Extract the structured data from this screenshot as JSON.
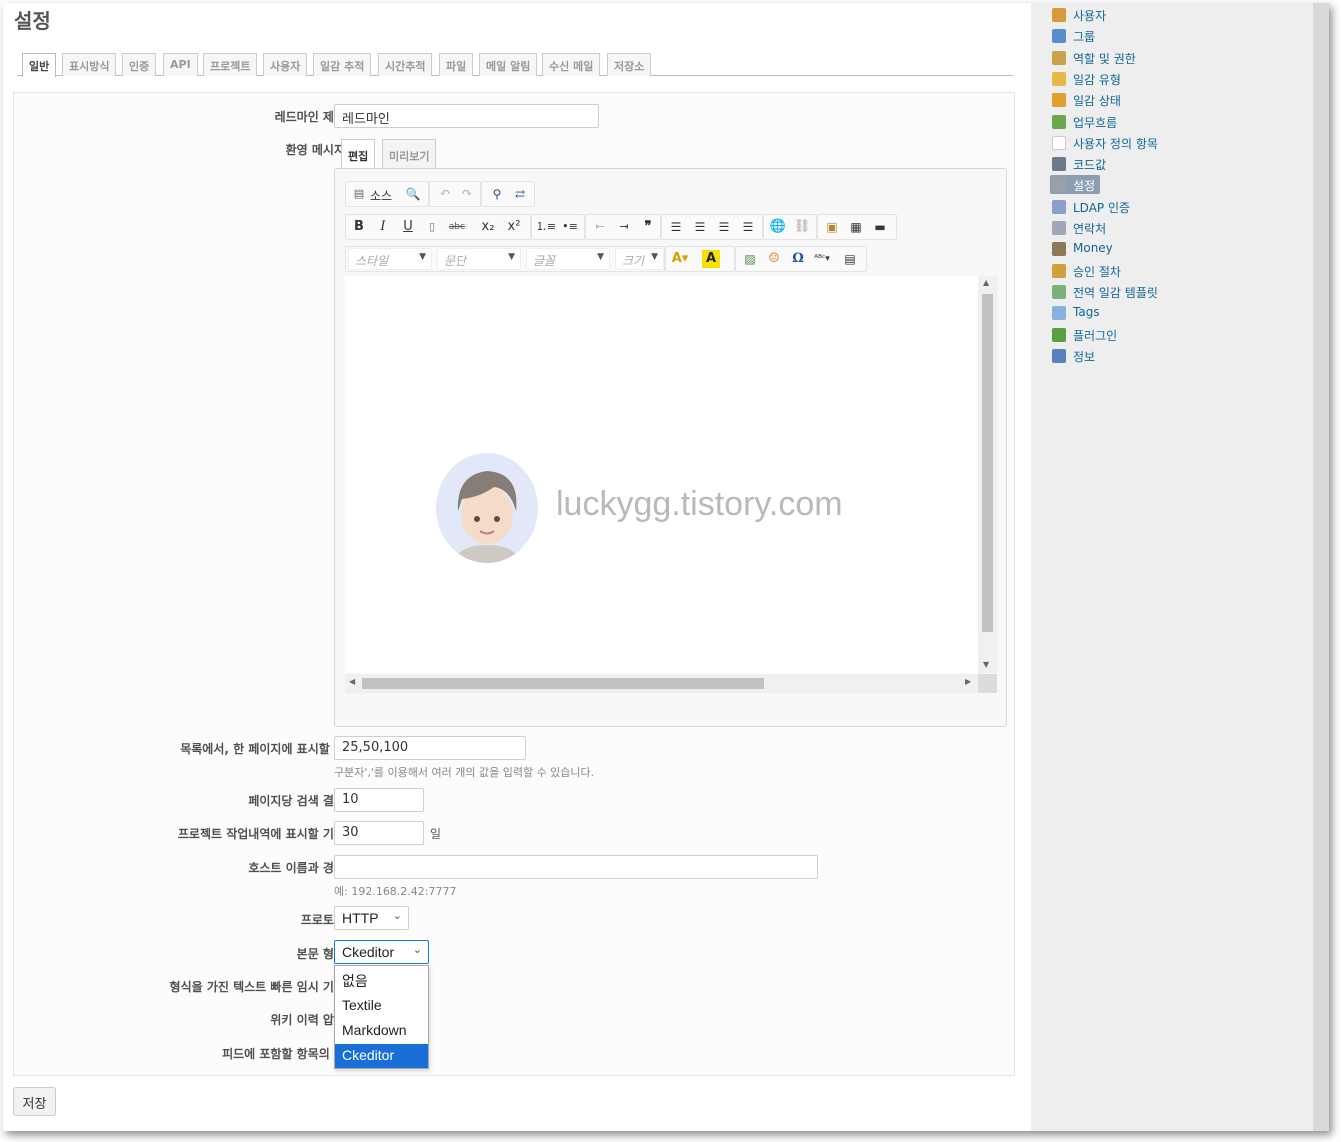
{
  "page": {
    "title": "설정"
  },
  "tabs": [
    "일반",
    "표시방식",
    "인증",
    "API",
    "프로젝트",
    "사용자",
    "일감 추적",
    "시간추적",
    "파일",
    "메일 알림",
    "수신 메일",
    "저장소"
  ],
  "form": {
    "app_title_label": "레드마인 제목",
    "app_title_value": "레드마인",
    "welcome_label": "환영 메시지",
    "editor_tabs": {
      "edit": "편집",
      "preview": "미리보기"
    },
    "toolbar": {
      "source": "소스",
      "combos": {
        "style": "스타일",
        "format": "문단",
        "font": "글꼴",
        "size": "크기"
      }
    },
    "watermark": "luckygg.tistory.com",
    "per_page_label": "목록에서, 한 페이지에 표시할 행",
    "per_page_value": "25,50,100",
    "per_page_hint": "구분자','를 이용해서 여러 개의 값을 입력할 수 있습니다.",
    "search_results_label": "페이지당 검색 결과",
    "search_results_value": "10",
    "activity_days_label": "프로젝트 작업내역에 표시할 기간",
    "activity_days_value": "30",
    "activity_days_unit": "일",
    "host_label": "호스트 이름과 경로",
    "host_value": "",
    "host_hint": "예: 192.168.2.42:7777",
    "protocol_label": "프로토콜",
    "protocol_value": "HTTP",
    "text_format_label": "본문 형식",
    "text_format_value": "Ckeditor",
    "text_format_options": [
      "없음",
      "Textile",
      "Markdown",
      "Ckeditor"
    ],
    "text_format_selected_index": 3,
    "cache_label": "형식을 가진 텍스트 빠른 임시 기억",
    "wiki_compress_label": "위키 이력 압축",
    "feed_limit_label": "피드에 포함할 항목의 수"
  },
  "save_button": "저장",
  "sidebar": {
    "items": [
      {
        "label": "사용자",
        "icon": "user-icon",
        "color": "#d79a3a"
      },
      {
        "label": "그룹",
        "icon": "group-icon",
        "color": "#5b8bd0"
      },
      {
        "label": "역할 및 권한",
        "icon": "key-icon",
        "color": "#c9a34a"
      },
      {
        "label": "일감 유형",
        "icon": "ticket-icon",
        "color": "#e8b84a"
      },
      {
        "label": "일감 상태",
        "icon": "pencil-icon",
        "color": "#e0a030"
      },
      {
        "label": "업무흐름",
        "icon": "workflow-icon",
        "color": "#6aa84f"
      },
      {
        "label": "사용자 정의 항목",
        "icon": "custom-field-icon",
        "color": "#ffffff"
      },
      {
        "label": "코드값",
        "icon": "list-icon",
        "color": "#6a7a8a"
      },
      {
        "label": "설정",
        "icon": "gear-icon",
        "color": "#9aa0a8",
        "selected": true
      },
      {
        "label": "LDAP 인증",
        "icon": "server-icon",
        "color": "#8aa0c8"
      },
      {
        "label": "연락처",
        "icon": "contacts-icon",
        "color": "#a0a8b8"
      },
      {
        "label": "Money",
        "icon": "money-icon",
        "color": "#8a7a5a"
      },
      {
        "label": "승인 절차",
        "icon": "approval-icon",
        "color": "#d0a040"
      },
      {
        "label": "전역 일감 템플릿",
        "icon": "template-icon",
        "color": "#7ab07a"
      },
      {
        "label": "Tags",
        "icon": "tag-icon",
        "color": "#8ab0e0"
      },
      {
        "label": "플러그인",
        "icon": "plugin-icon",
        "color": "#5aa040"
      },
      {
        "label": "정보",
        "icon": "help-icon",
        "color": "#5a80c0"
      }
    ]
  }
}
